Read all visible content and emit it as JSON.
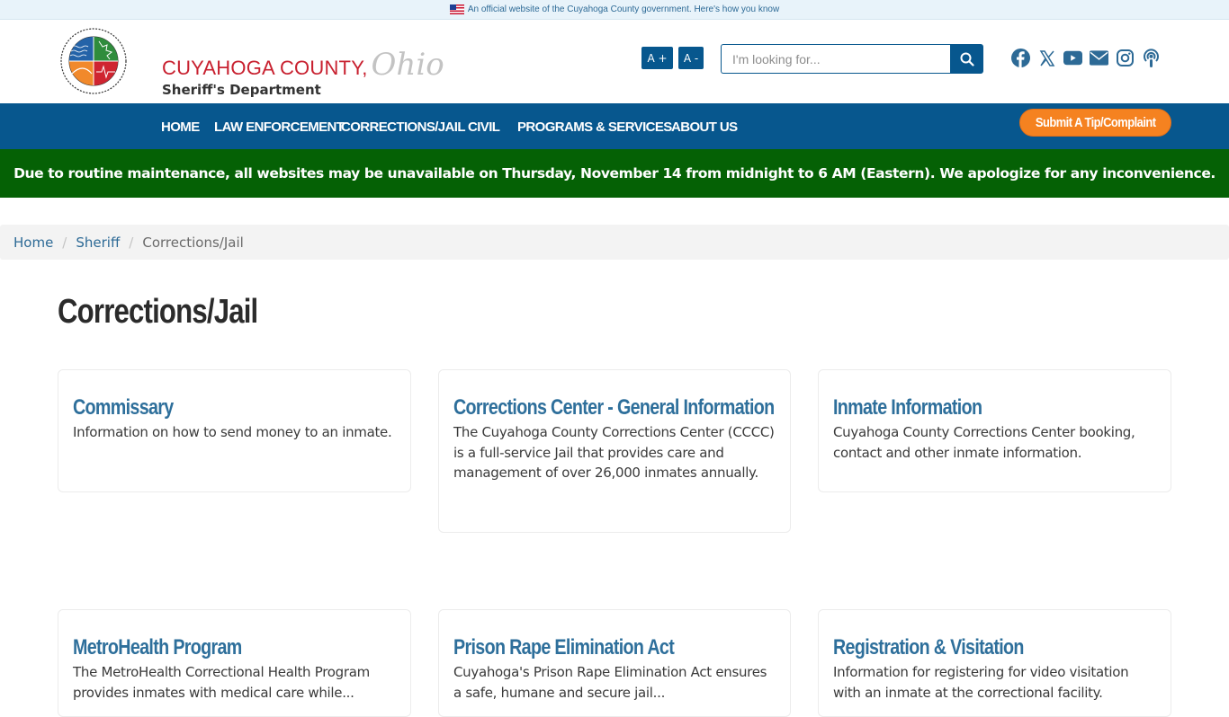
{
  "official_banner": {
    "text": "An official website of the Cuyahoga County government. Here's how you know"
  },
  "header": {
    "brand_county": "CUYAHOGA COUNTY,",
    "brand_state": "Ohio",
    "brand_department": "Sheriff's Department",
    "logo_alt": "County of Cuyahoga Ohio seal",
    "font_increase_label": "A +",
    "font_decrease_label": "A -",
    "search": {
      "placeholder": "I'm looking for...",
      "value": ""
    },
    "social_icons": [
      "facebook-icon",
      "x-icon",
      "youtube-icon",
      "email-icon",
      "instagram-icon",
      "podcast-icon"
    ]
  },
  "nav": {
    "items": [
      {
        "label": "HOME"
      },
      {
        "label": "LAW ENFORCEMENT"
      },
      {
        "label": "CORRECTIONS/JAIL"
      },
      {
        "label": "CIVIL"
      },
      {
        "label": "PROGRAMS & SERVICES"
      },
      {
        "label": "ABOUT US"
      }
    ],
    "tip_button": "Submit A Tip/Complaint"
  },
  "alert": {
    "text": "Due to routine maintenance, all websites may be unavailable on Thursday, November 14 from midnight to 6 AM (Eastern). We apologize for any inconvenience."
  },
  "breadcrumb": {
    "items": [
      {
        "label": "Home"
      },
      {
        "label": "Sheriff"
      },
      {
        "label": "Corrections/Jail"
      }
    ],
    "separator": "/"
  },
  "main": {
    "title": "Corrections/Jail",
    "cards": [
      {
        "title": "Commissary",
        "description": "Information on how to send money to an inmate."
      },
      {
        "title": "Corrections Center - General Information",
        "description": "The Cuyahoga County Corrections Center (CCCC) is a full-service Jail that provides care and management of over 26,000 inmates annually."
      },
      {
        "title": "Inmate Information",
        "description": "Cuyahoga County Corrections Center booking, contact and other inmate information."
      },
      {
        "title": "MetroHealth Program",
        "description": "The MetroHealth Correctional Health Program provides inmates with medical care while..."
      },
      {
        "title": "Prison Rape Elimination Act",
        "description": "Cuyahoga's Prison Rape Elimination Act ensures a safe, humane and secure jail..."
      },
      {
        "title": "Registration & Visitation",
        "description": "Information for registering for video visitation with an inmate at the correctional facility."
      }
    ]
  },
  "colors": {
    "primary_blue": "#07578e",
    "alert_green": "#056105",
    "tip_orange": "#f58220",
    "card_title_blue": "#2e6f9b",
    "brand_red": "#c8202f"
  }
}
